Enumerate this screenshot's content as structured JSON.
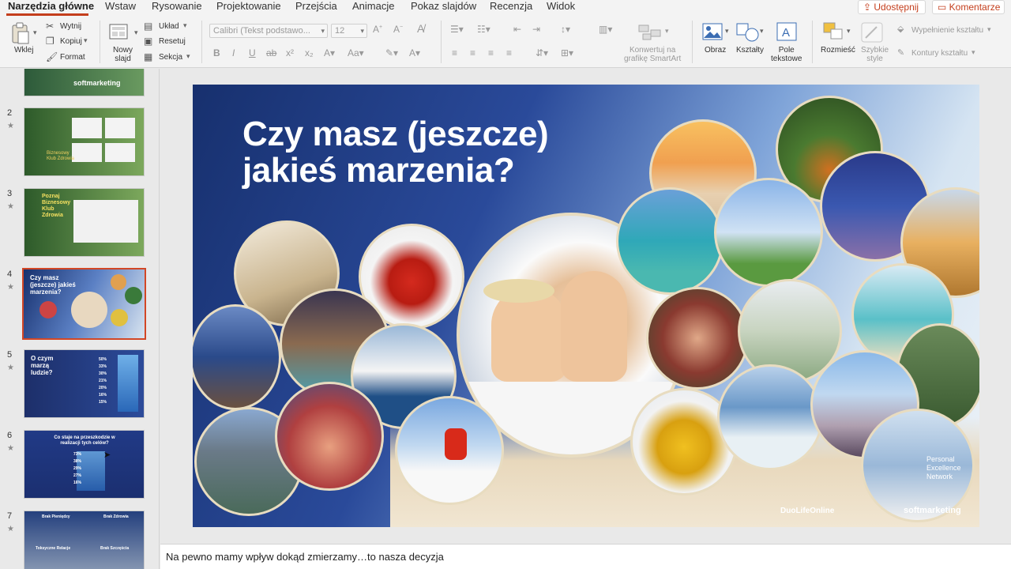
{
  "menu_tabs": [
    "Narzędzia główne",
    "Wstaw",
    "Rysowanie",
    "Projektowanie",
    "Przejścia",
    "Animacje",
    "Pokaz slajdów",
    "Recenzja",
    "Widok"
  ],
  "share_label": "Udostępnij",
  "comments_label": "Komentarze",
  "ribbon": {
    "paste": "Wklej",
    "cut": "Wytnij",
    "copy": "Kopiuj",
    "format": "Format",
    "new_slide": "Nowy\nslajd",
    "layout": "Układ",
    "reset": "Resetuj",
    "section": "Sekcja",
    "font_name": "Calibri (Tekst podstawo...",
    "font_size": "12",
    "smartart": "Konwertuj na\ngrafikę SmartArt",
    "picture": "Obraz",
    "shapes": "Kształty",
    "text_box": "Pole\ntekstowe",
    "arrange": "Rozmieść",
    "quick_styles": "Szybkie\nstyle",
    "shape_fill": "Wypełnienie kształtu",
    "shape_outline": "Kontury kształtu"
  },
  "thumbnails": [
    {
      "num": "",
      "label": "softmarketing"
    },
    {
      "num": "2",
      "label": "Biznesowy Klub Zdrowia"
    },
    {
      "num": "3",
      "label": "Poznaj Biznesowy Klub Zdrowia"
    },
    {
      "num": "4",
      "label": "Czy masz (jeszcze) jakieś marzenia?"
    },
    {
      "num": "5",
      "label": "O czym marzą ludzie?"
    },
    {
      "num": "6",
      "label": "Co staje na przeszkodzie w realizacji tych celów?"
    },
    {
      "num": "7",
      "label": ""
    }
  ],
  "thumb_texts": {
    "t5_values": [
      "50%",
      "33%",
      "30%",
      "21%",
      "20%",
      "16%",
      "15%"
    ],
    "t6_values": [
      "73%",
      "38%",
      "29%",
      "27%",
      "16%"
    ],
    "t7_labels": [
      "Brak Pieniędzy",
      "Brak Zdrowia",
      "Toksyczne Relacje",
      "Brak Szczęścia"
    ]
  },
  "slide": {
    "title": "Czy masz (jeszcze)\njakieś marzenia?",
    "pen_text": "Personal\nExcellence\nNetwork",
    "logo_duolife": "DuoLifeOnline",
    "logo_soft": "softmarketing"
  },
  "notes": "Na pewno mamy wpływ dokąd  zmierzamy…to nasza decyzja"
}
